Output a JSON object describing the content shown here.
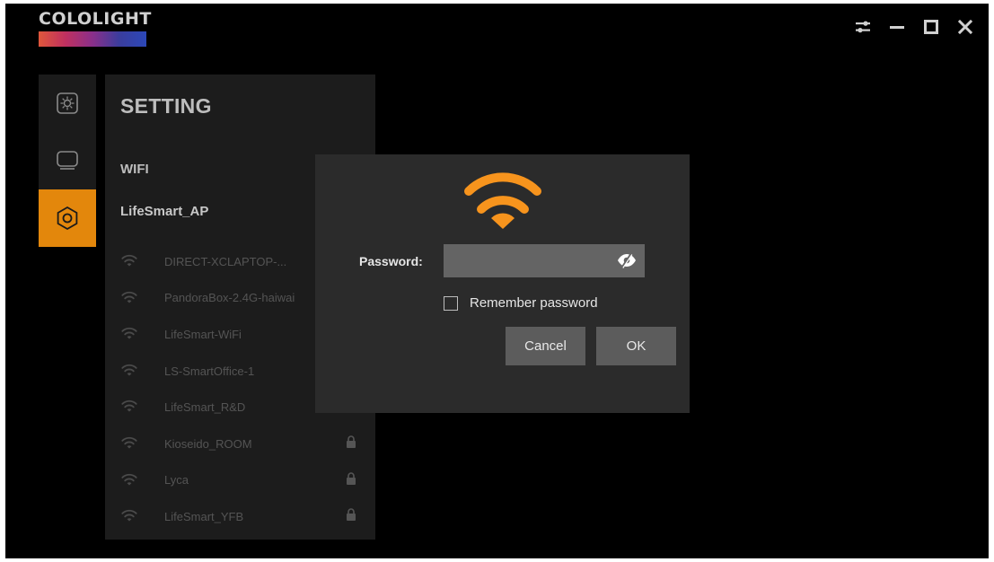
{
  "app": {
    "brand_name": "COLOLIGHT"
  },
  "window_controls": [
    "settings-sliders-icon",
    "minimize-icon",
    "maximize-icon",
    "close-icon"
  ],
  "nav": {
    "items": [
      {
        "name": "light-effects",
        "icon": "sun-icon"
      },
      {
        "name": "display",
        "icon": "monitor-icon"
      },
      {
        "name": "settings",
        "icon": "hexagon-gear-icon",
        "active": true
      }
    ]
  },
  "settings": {
    "title": "SETTING",
    "wifi_label": "WIFI",
    "current_network": "LifeSmart_AP",
    "networks": [
      {
        "ssid": "DIRECT-XCLAPTOP-...",
        "locked": false
      },
      {
        "ssid": "PandoraBox-2.4G-haiwai",
        "locked": false
      },
      {
        "ssid": "LifeSmart-WiFi",
        "locked": false
      },
      {
        "ssid": "LS-SmartOffice-1",
        "locked": false
      },
      {
        "ssid": "LifeSmart_R&D",
        "locked": false
      },
      {
        "ssid": "Kioseido_ROOM",
        "locked": true
      },
      {
        "ssid": "Lyca",
        "locked": true
      },
      {
        "ssid": "LifeSmart_YFB",
        "locked": true
      }
    ]
  },
  "dialog": {
    "password_label": "Password:",
    "password_value": "",
    "remember_label": "Remember password",
    "remember_checked": false,
    "cancel_label": "Cancel",
    "ok_label": "OK"
  },
  "colors": {
    "accent": "#e3870c",
    "wifi_orange": "#f7941d",
    "background": "#000000",
    "panel": "#1c1c1c",
    "dialog": "#2b2b2b"
  }
}
